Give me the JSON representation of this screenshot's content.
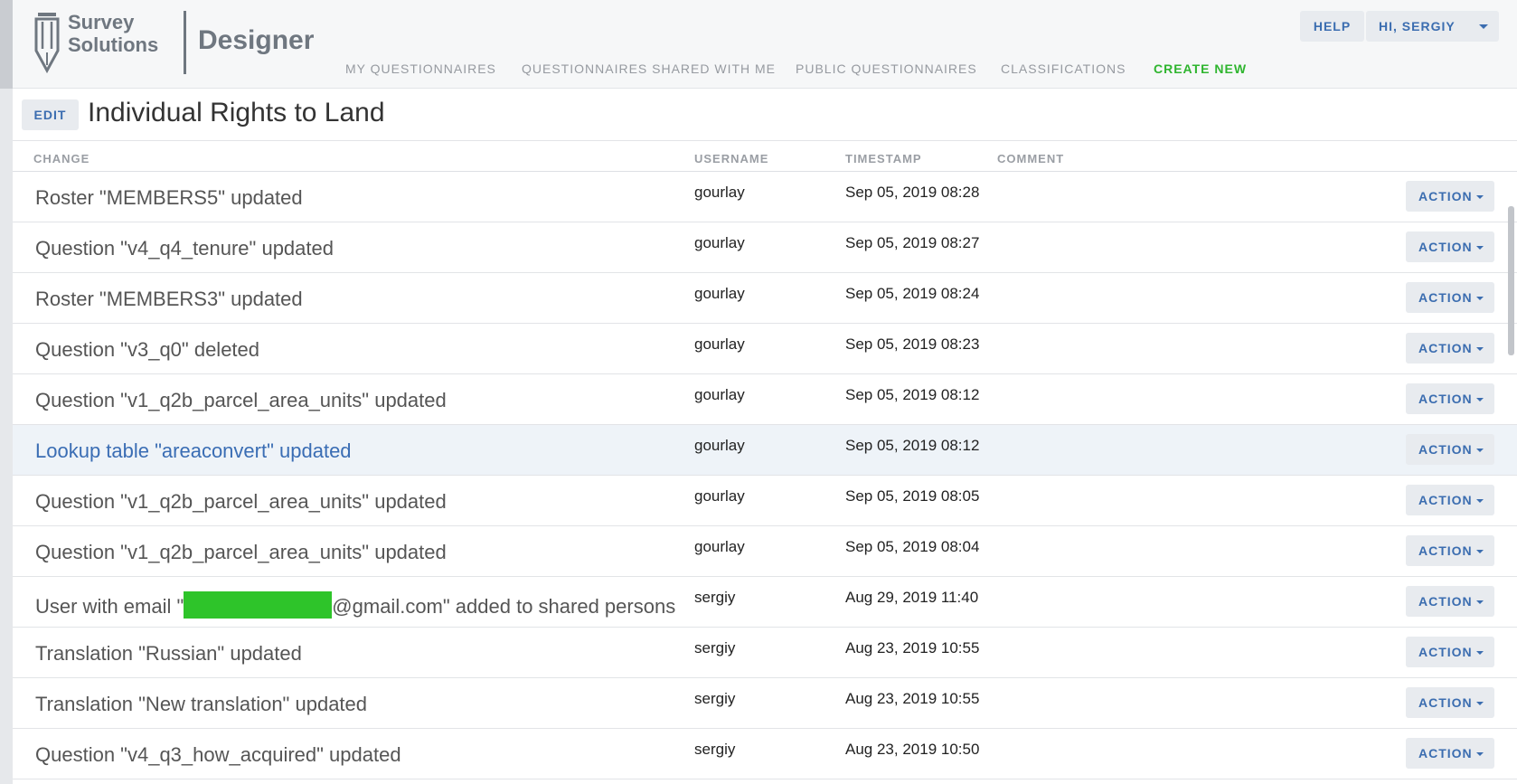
{
  "header": {
    "logo_line1": "Survey",
    "logo_line2": "Solutions",
    "app_name": "Designer",
    "help_label": "HELP",
    "user_label": "HI, SERGIY",
    "nav": [
      {
        "label": "MY QUESTIONNAIRES"
      },
      {
        "label": "QUESTIONNAIRES SHARED WITH ME"
      },
      {
        "label": "PUBLIC QUESTIONNAIRES"
      },
      {
        "label": "CLASSIFICATIONS"
      },
      {
        "label": "CREATE NEW"
      }
    ]
  },
  "page": {
    "edit_label": "EDIT",
    "title": "Individual Rights to Land"
  },
  "table": {
    "headers": {
      "change": "CHANGE",
      "username": "USERNAME",
      "timestamp": "TIMESTAMP",
      "comment": "COMMENT"
    },
    "action_label": "ACTION",
    "rows": [
      {
        "change": "Roster \"MEMBERS5\" updated",
        "username": "gourlay",
        "timestamp": "Sep 05, 2019 08:28"
      },
      {
        "change": "Question \"v4_q4_tenure\" updated",
        "username": "gourlay",
        "timestamp": "Sep 05, 2019 08:27"
      },
      {
        "change": "Roster \"MEMBERS3\" updated",
        "username": "gourlay",
        "timestamp": "Sep 05, 2019 08:24"
      },
      {
        "change": "Question \"v3_q0\" deleted",
        "username": "gourlay",
        "timestamp": "Sep 05, 2019 08:23"
      },
      {
        "change": "Question \"v1_q2b_parcel_area_units\" updated",
        "username": "gourlay",
        "timestamp": "Sep 05, 2019 08:12"
      },
      {
        "change": "Lookup table \"areaconvert\" updated",
        "username": "gourlay",
        "timestamp": "Sep 05, 2019 08:12"
      },
      {
        "change": "Question \"v1_q2b_parcel_area_units\" updated",
        "username": "gourlay",
        "timestamp": "Sep 05, 2019 08:05"
      },
      {
        "change": "Question \"v1_q2b_parcel_area_units\" updated",
        "username": "gourlay",
        "timestamp": "Sep 05, 2019 08:04"
      },
      {
        "change_prefix": "User with email \"",
        "change_suffix": "@gmail.com\" added to shared persons",
        "username": "sergiy",
        "timestamp": "Aug 29, 2019 11:40"
      },
      {
        "change": "Translation \"Russian\" updated",
        "username": "sergiy",
        "timestamp": "Aug 23, 2019 10:55"
      },
      {
        "change": "Translation \"New translation\" updated",
        "username": "sergiy",
        "timestamp": "Aug 23, 2019 10:55"
      },
      {
        "change": "Question \"v4_q3_how_acquired\" updated",
        "username": "sergiy",
        "timestamp": "Aug 23, 2019 10:50"
      }
    ]
  },
  "colors": {
    "accent": "#3b6db0",
    "create_new": "#2fb52f",
    "highlight_row": "#eef3f8"
  }
}
